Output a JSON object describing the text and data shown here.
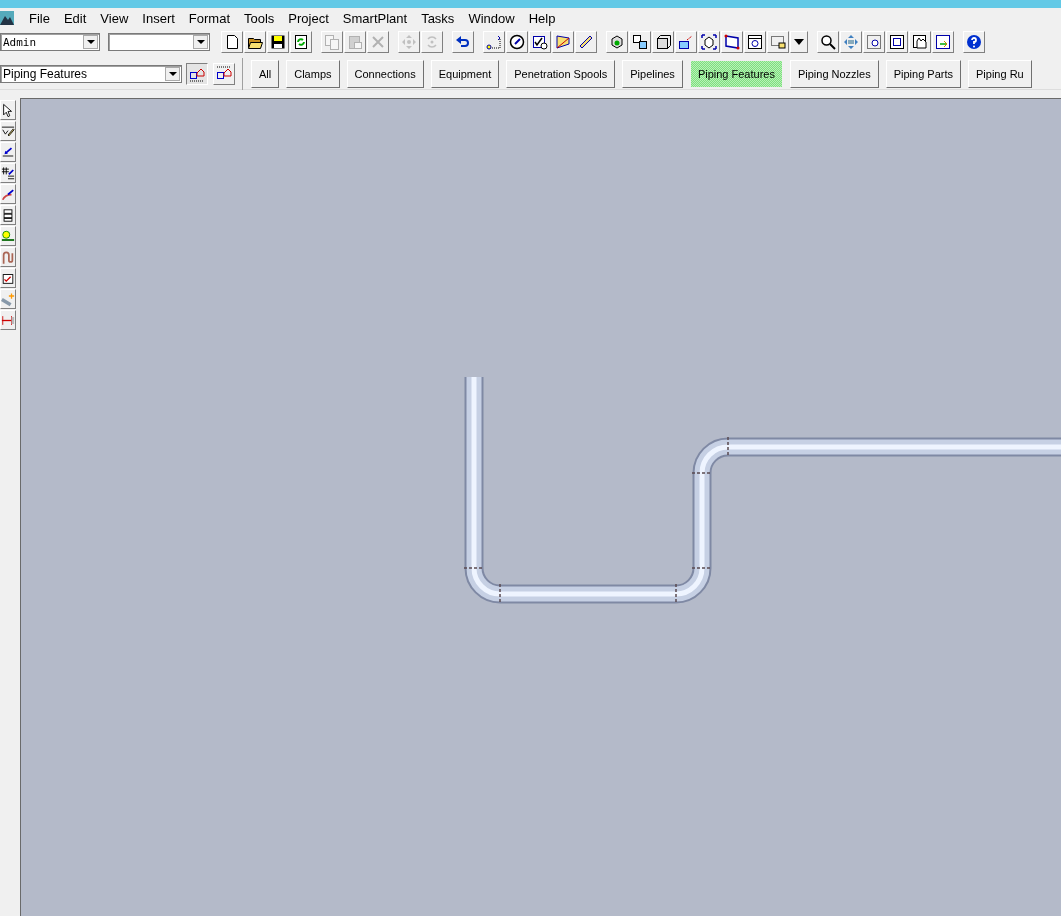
{
  "menu": [
    "File",
    "Edit",
    "View",
    "Insert",
    "Format",
    "Tools",
    "Project",
    "SmartPlant",
    "Tasks",
    "Window",
    "Help"
  ],
  "toolbar": {
    "user_combo": {
      "value": "Admin"
    },
    "buttons": [
      {
        "disabled": false
      },
      {
        "disabled": false
      },
      {
        "disabled": false
      },
      {
        "disabled": false
      },
      {
        "disabled": true
      },
      {
        "disabled": true
      },
      {
        "disabled": true
      },
      {
        "disabled": true
      },
      {
        "disabled": true
      },
      {
        "disabled": false
      },
      {
        "disabled": false
      },
      {
        "disabled": false
      },
      {
        "disabled": false
      },
      {
        "disabled": false
      },
      {
        "disabled": false
      },
      {
        "disabled": false
      },
      {
        "disabled": false
      },
      {
        "disabled": false
      },
      {
        "disabled": false
      },
      {
        "disabled": false
      },
      {
        "disabled": false
      },
      {
        "disabled": false
      },
      {
        "disabled": false
      },
      {
        "disabled": false
      },
      {
        "disabled": false
      },
      {
        "disabled": false
      },
      {
        "disabled": false
      },
      {
        "disabled": false
      },
      {
        "disabled": false
      },
      {
        "disabled": false
      }
    ]
  },
  "filter_combo": {
    "value": "Piping Features"
  },
  "tabs": [
    {
      "label": "All",
      "selected": false
    },
    {
      "label": "Clamps",
      "selected": false
    },
    {
      "label": "Connections",
      "selected": false
    },
    {
      "label": "Equipment",
      "selected": false
    },
    {
      "label": "Penetration Spools",
      "selected": false
    },
    {
      "label": "Pipelines",
      "selected": false
    },
    {
      "label": "Piping Features",
      "selected": true
    },
    {
      "label": "Piping Nozzles",
      "selected": false
    },
    {
      "label": "Piping Parts",
      "selected": false
    },
    {
      "label": "Piping Ru",
      "selected": false
    }
  ]
}
